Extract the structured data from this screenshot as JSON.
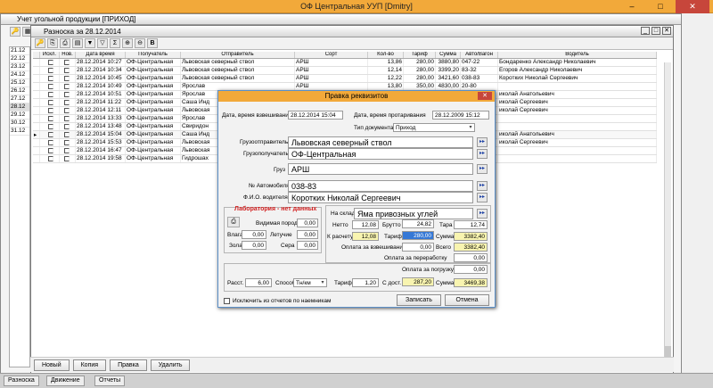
{
  "app": {
    "title": "ОФ Центральная УУП  [Dmitry]"
  },
  "win2": {
    "title": "Учет угольной продукции [ПРИХОД]"
  },
  "win3": {
    "title": "Разноска за 28.12.2014"
  },
  "leftcol": [
    "21.12",
    "22.12",
    "23.12",
    "24.12",
    "25.12",
    "26.12",
    "27.12",
    "28.12",
    "29.12",
    "30.12",
    "31.12"
  ],
  "grid": {
    "headers": [
      "Искл.",
      "Нов.",
      "Дата время",
      "Получатель",
      "Отправитель",
      "Сорт",
      "Кол-во",
      "Тариф",
      "Сумма",
      "Авто/Вагон",
      "Водитель"
    ],
    "rows": [
      [
        "28.12.2014 10:27",
        "ОФ-Центральная",
        "Львовская северный ствол",
        "АРШ",
        "13,86",
        "280,00",
        "3880,80",
        "047-22",
        "Бондаренко Александр Николаевич"
      ],
      [
        "28.12.2014 10:34",
        "ОФ-Центральная",
        "Львовская северный ствол",
        "АРШ",
        "12,14",
        "280,00",
        "3399,20",
        "83-32",
        "Егоров Александр Николаевич"
      ],
      [
        "28.12.2014 10:45",
        "ОФ-Центральная",
        "Львовская северный ствол",
        "АРШ",
        "12,22",
        "280,00",
        "3421,60",
        "038-83",
        "Коротких Николай Сергеевич"
      ],
      [
        "28.12.2014 10:49",
        "ОФ-Центральная",
        "Ярослав",
        "АРШ",
        "13,80",
        "350,00",
        "4830,00",
        "20-80",
        ""
      ],
      [
        "28.12.2014 10:51",
        "ОФ-Центральная",
        "Ярослав",
        "",
        "",
        "",
        "",
        "",
        "иколай Анатольевич"
      ],
      [
        "28.12.2014 11:22",
        "ОФ-Центральная",
        "Саша  Инд",
        "",
        "",
        "",
        "",
        "",
        "иколай Сергеевич"
      ],
      [
        "28.12.2014 12:11",
        "ОФ-Центральная",
        "Львовская",
        "",
        "",
        "",
        "",
        "",
        "иколай Сергеевич"
      ],
      [
        "28.12.2014 13:33",
        "ОФ-Центральная",
        "Ярослав",
        "",
        "",
        "",
        "",
        "",
        ""
      ],
      [
        "28.12.2014 13:48",
        "ОФ-Центральная",
        "Свиридон",
        "",
        "",
        "",
        "",
        "",
        ""
      ],
      [
        "28.12.2014 15:04",
        "ОФ-Центральная",
        "Саша  Инд",
        "",
        "",
        "",
        "",
        "",
        "иколай Анатольевич"
      ],
      [
        "28.12.2014 15:53",
        "ОФ-Центральная",
        "Львовская",
        "",
        "",
        "",
        "",
        "",
        "иколай Сергеевич"
      ],
      [
        "28.12.2014 16:47",
        "ОФ-Центральная",
        "Львовская",
        "",
        "",
        "",
        "",
        "",
        ""
      ],
      [
        "28.12.2014 19:58",
        "ОФ-Центральная",
        "Гидрошах",
        "",
        "",
        "",
        "",
        "",
        ""
      ]
    ]
  },
  "bottom": {
    "new": "Новый",
    "copy": "Копия",
    "edit": "Правка",
    "delete": "Удалить"
  },
  "tabs": [
    "Разноска",
    "Движение",
    "Отчеты"
  ],
  "dialog": {
    "title": "Правка реквизитов",
    "weigh_label": "Дата, время взвешивания",
    "weigh_value": "28.12.2014 15:04",
    "thaw_label": "Дата, время протаривания",
    "thaw_value": "28.12.2009 15:12",
    "doctype_label": "Тип документа",
    "doctype_value": "Приход",
    "sender_label": "Грузоотправитель",
    "sender_value": "Львовская северный ствол",
    "receiver_label": "Грузополучатель",
    "receiver_value": "ОФ-Центральная",
    "cargo_label": "Груз",
    "cargo_value": "АРШ",
    "car_label": "№ Автомобиля",
    "car_value": "038-83",
    "driver_label": "Ф.И.О. водителя",
    "driver_value": "Коротких Николай Сергеевич",
    "lab_title": "Лаборатория - нет данных",
    "rock_label": "Видимая порода",
    "rock_value": "0,00",
    "moist_label": "Влага",
    "moist_value": "0,00",
    "vol_label": "Летучие",
    "vol_value": "0,00",
    "ash_label": "Зола",
    "ash_value": "0,00",
    "sulf_label": "Сера",
    "sulf_value": "0,00",
    "store_label": "На склад",
    "store_value": "Яма привозных углей",
    "net_label": "Нетто",
    "net_value": "12,08",
    "gross_label": "Брутто",
    "gross_value": "24,82",
    "tare_label": "Тара",
    "tare_value": "12,74",
    "calc_label": "К расчету",
    "calc_value": "12,08",
    "tariff_label": "Тариф",
    "tariff_value": "280,00",
    "sum_label": "Сумма",
    "sum_value": "3382,40",
    "payweigh_label": "Оплата за взвешивание",
    "payweigh_value": "0,00",
    "total_label": "Всего",
    "total_value": "3382,40",
    "payproc_label": "Оплата за переработку",
    "payproc_value": "0,00",
    "payload_label": "Оплата за погрузку",
    "payload_value": "0,00",
    "dist_label": "Расст.",
    "dist_value": "6,00",
    "method_label": "Способ",
    "method_value": "Тн/км",
    "tariff2_label": "Тариф",
    "tariff2_value": "1,20",
    "deliv_label": "С дост.",
    "deliv_value": "287,20",
    "sum2_label": "Сумма",
    "sum2_value": "3469,38",
    "exclude_label": "Исключить из отчетов по наемникам",
    "save": "Записать",
    "cancel": "Отмена"
  }
}
